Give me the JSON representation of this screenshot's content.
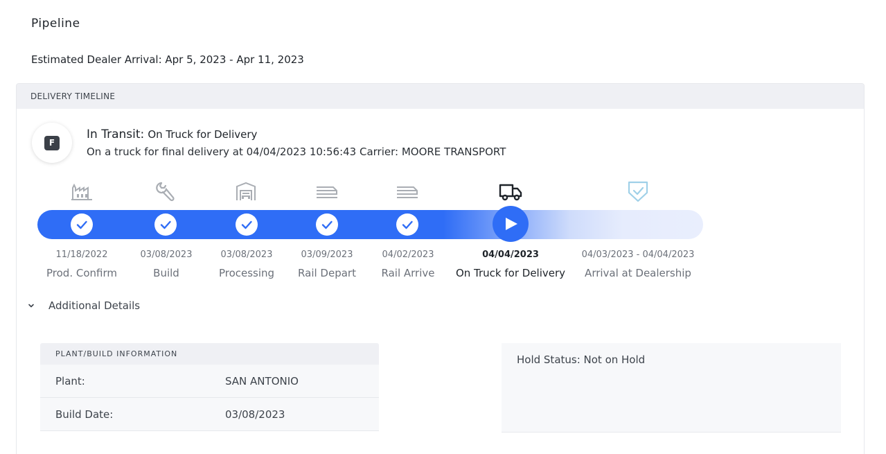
{
  "page": {
    "title": "Pipeline",
    "estimated_arrival": "Estimated Dealer Arrival: Apr 5, 2023 - Apr 11, 2023"
  },
  "timeline": {
    "header": "DELIVERY TIMELINE",
    "badge_letter": "F",
    "status_label": "In Transit:",
    "status_detail": "On Truck for Delivery",
    "status_description": "On a truck for final delivery at 04/04/2023 10:56:43 Carrier: MOORE TRANSPORT",
    "stages": [
      {
        "name": "Prod. Confirm",
        "date": "11/18/2022",
        "icon": "factory-icon",
        "state": "complete"
      },
      {
        "name": "Build",
        "date": "03/08/2023",
        "icon": "wrench-icon",
        "state": "complete"
      },
      {
        "name": "Processing",
        "date": "03/08/2023",
        "icon": "processing-icon",
        "state": "complete"
      },
      {
        "name": "Rail Depart",
        "date": "03/09/2023",
        "icon": "rail-icon",
        "state": "complete"
      },
      {
        "name": "Rail Arrive",
        "date": "04/02/2023",
        "icon": "rail-icon",
        "state": "complete"
      },
      {
        "name": "On Truck for Delivery",
        "date": "04/04/2023",
        "icon": "truck-icon",
        "state": "current"
      },
      {
        "name": "Arrival at Dealership",
        "date": "04/03/2023 - 04/04/2023",
        "icon": "shield-check-icon",
        "state": "pending"
      }
    ],
    "colors": {
      "accent": "#2f6df6",
      "pending_track": "#e9eefd",
      "muted_icon": "#a9adb3",
      "pending_icon": "#9fd0e8"
    }
  },
  "additional_details": {
    "toggle_label": "Additional Details",
    "plant_info": {
      "header": "PLANT/BUILD INFORMATION",
      "rows": [
        {
          "label": "Plant:",
          "value": "SAN ANTONIO"
        },
        {
          "label": "Build Date:",
          "value": "03/08/2023"
        }
      ]
    },
    "hold_status": "Hold Status: Not on Hold"
  }
}
